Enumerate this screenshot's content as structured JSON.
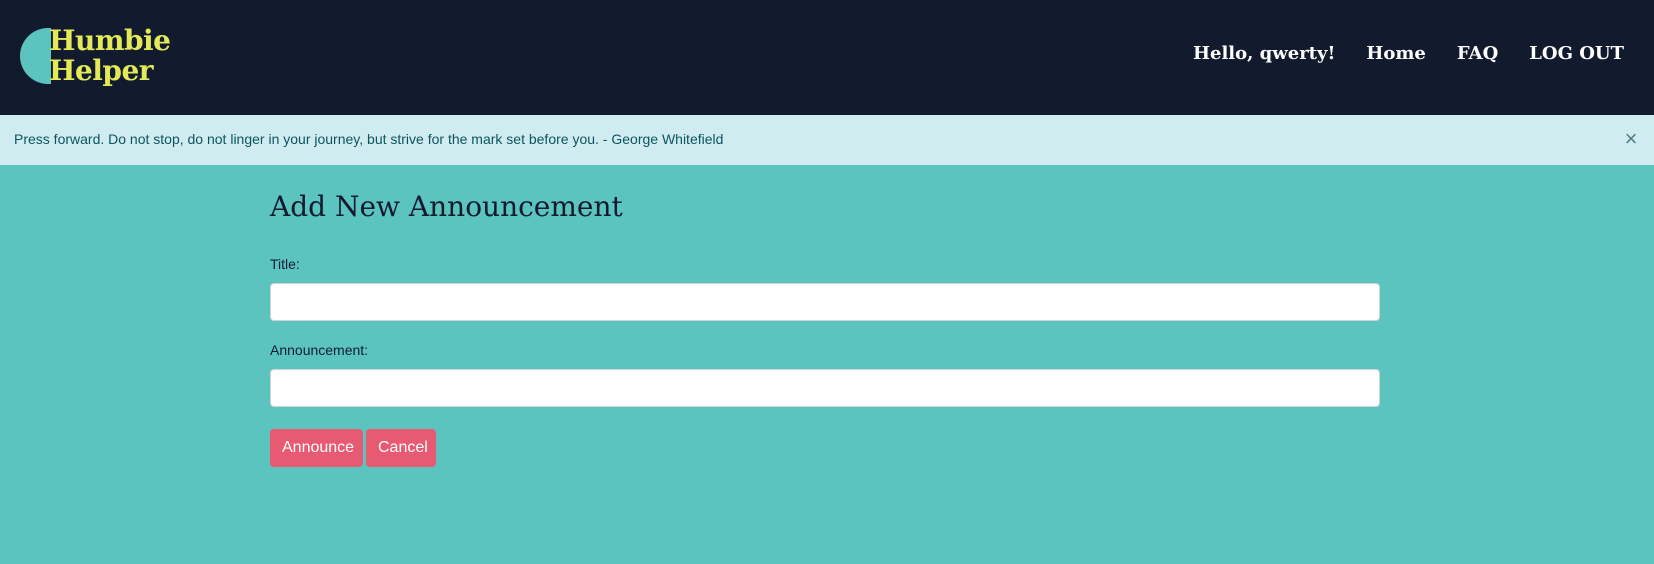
{
  "brand": {
    "line1": "Humbie",
    "line2": "Helper",
    "accent_color": "#e3e957",
    "mark_color": "#5bc4bf"
  },
  "nav": {
    "greeting": "Hello, qwerty!",
    "home": "Home",
    "faq": "FAQ",
    "logout": "LOG OUT"
  },
  "alert": {
    "text": "Press forward. Do not stop, do not linger in your journey, but strive for the mark set before you. - George Whitefield",
    "close": "×"
  },
  "form": {
    "heading": "Add New Announcement",
    "title_label": "Title:",
    "title_value": "",
    "announcement_label": "Announcement:",
    "announcement_value": "",
    "submit_label": "Announce",
    "cancel_label": "Cancel"
  },
  "colors": {
    "navbar": "#121b2e",
    "background": "#5bc4bf",
    "alert_bg": "#d1ecf1",
    "button": "#e75a72"
  }
}
